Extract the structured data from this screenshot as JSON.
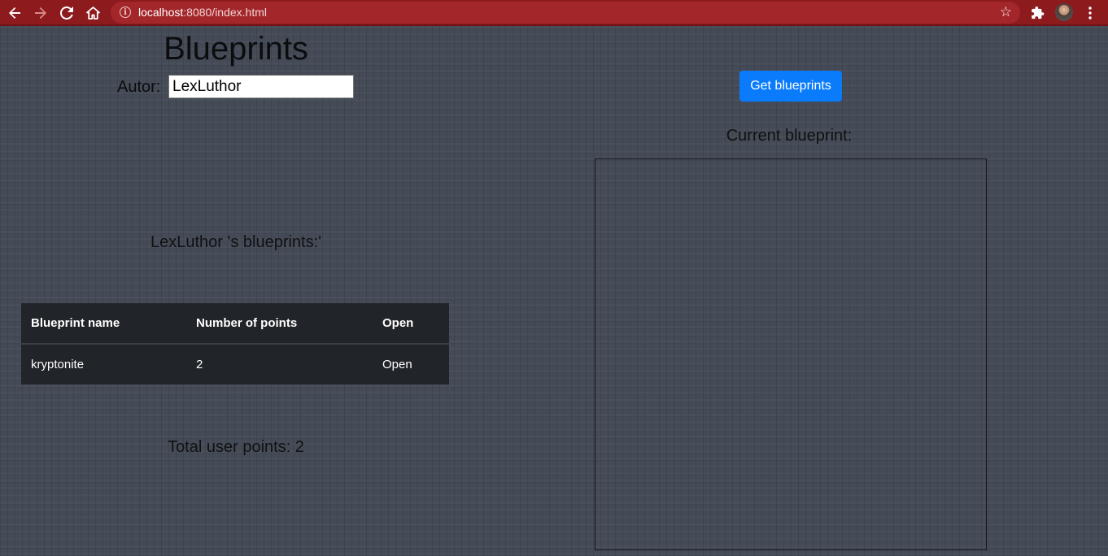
{
  "browser": {
    "url_host": "localhost",
    "url_rest": ":8080/index.html"
  },
  "page": {
    "title": "Blueprints",
    "autor_label": "Autor:",
    "autor_value": "LexLuthor",
    "get_button_label": "Get blueprints",
    "current_blueprint_heading": "Current blueprint:",
    "author_blueprints_heading": "LexLuthor 's blueprints:'",
    "total_points_heading": "Total user points: 2"
  },
  "table": {
    "headers": [
      "Blueprint name",
      "Number of points",
      "Open"
    ],
    "rows": [
      {
        "name": "kryptonite",
        "points": "2",
        "open": "Open"
      }
    ]
  },
  "icons": {
    "back": "arrow-left-icon",
    "forward": "arrow-right-icon",
    "reload": "reload-icon",
    "home": "home-icon",
    "info": "info-icon",
    "bookmark": "star-icon",
    "extensions": "puzzle-icon",
    "menu": "kebab-menu-icon"
  },
  "colors": {
    "chrome": "#8d1a1d",
    "button": "#0a7cfb",
    "table_bg": "#212428"
  }
}
